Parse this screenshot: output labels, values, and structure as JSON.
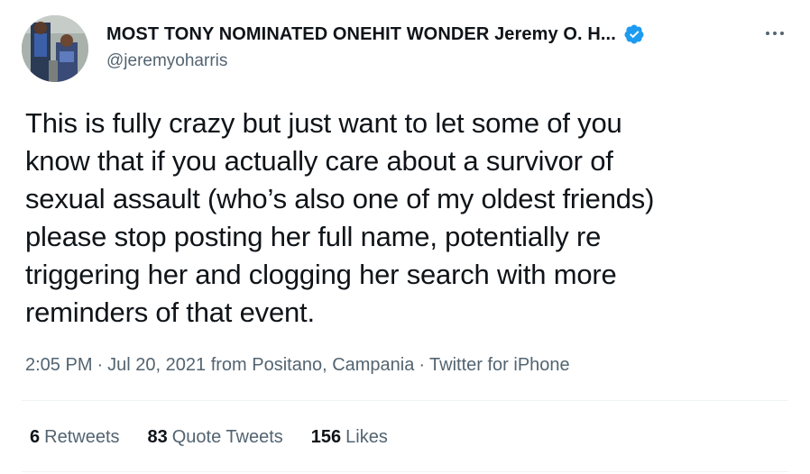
{
  "author": {
    "display_name": "MOST TONY NOMINATED ONEHIT WONDER Jeremy O. H...",
    "handle": "@jeremyoharris",
    "verified_icon": "verified-badge-icon",
    "verified_color": "#1d9bf0"
  },
  "tweet": {
    "lines": [
      "This is fully crazy but just want to let some of you",
      "know that if you actually care about a survivor of",
      "sexual assault (who’s also one of my oldest friends)",
      "please stop posting her full name, potentially re",
      "triggering her and clogging her search with more",
      "reminders of that event."
    ]
  },
  "meta": {
    "time": "2:05 PM",
    "date": "Jul 20, 2021",
    "location": "from Positano, Campania",
    "source": "Twitter for iPhone",
    "separator": "·"
  },
  "stats": {
    "retweets_count": "6",
    "retweets_label": "Retweets",
    "quotes_count": "83",
    "quotes_label": "Quote Tweets",
    "likes_count": "156",
    "likes_label": "Likes"
  },
  "colors": {
    "text_primary": "#0f1419",
    "text_secondary": "#536471",
    "divider": "#eff3f4",
    "accent": "#1d9bf0"
  }
}
